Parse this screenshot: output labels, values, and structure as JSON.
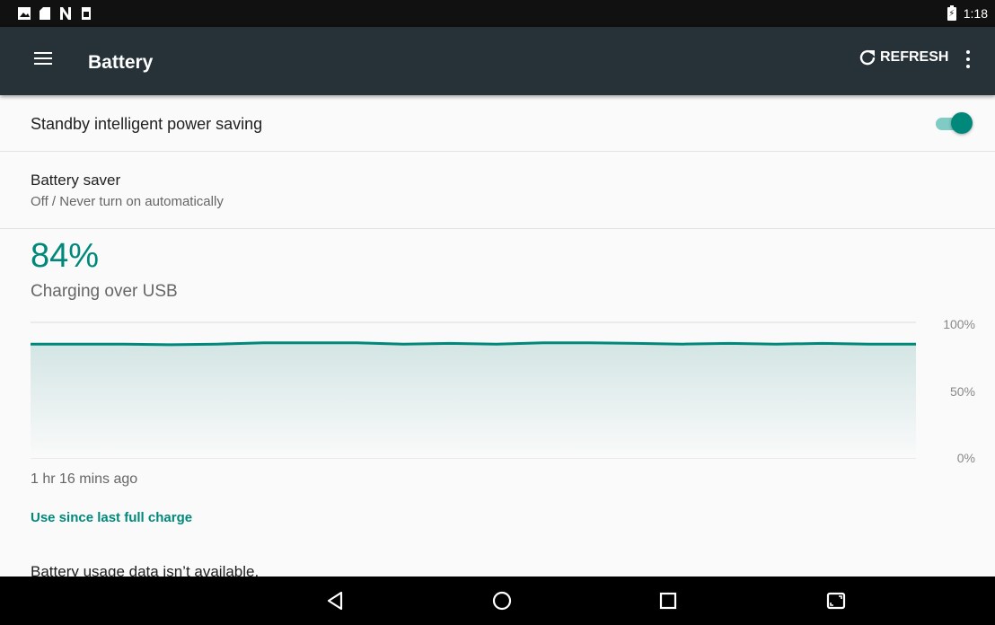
{
  "status_bar": {
    "time": "1:18",
    "icons": [
      "image-icon",
      "sd-card-icon",
      "n-icon",
      "storage-icon",
      "battery-charging-icon"
    ]
  },
  "app_bar": {
    "title": "Battery",
    "refresh_label": "REFRESH",
    "menu_icon": "menu-icon",
    "overflow_icon": "more-vert-icon"
  },
  "settings": {
    "standby_label": "Standby intelligent power saving",
    "standby_enabled": true,
    "saver_title": "Battery saver",
    "saver_summary": "Off / Never turn on automatically"
  },
  "battery": {
    "percent": "84%",
    "status": "Charging over USB",
    "time_ago": "1 hr 16 mins ago",
    "use_since_link": "Use since last full charge",
    "no_data_text": "Battery usage data isn’t available."
  },
  "chart_data": {
    "type": "area",
    "y_ticks": [
      "100%",
      "50%",
      "0%"
    ],
    "ylim": [
      0,
      100
    ],
    "grid": true,
    "x": [
      0,
      4,
      8,
      12,
      16,
      20,
      24,
      28,
      32,
      36,
      40,
      44,
      48,
      52,
      56,
      60,
      64,
      68,
      72,
      76
    ],
    "values": [
      84,
      84,
      84,
      83.5,
      84,
      85,
      85,
      85,
      84,
      84.5,
      84,
      85,
      85,
      84.5,
      84,
      84.5,
      84,
      84.5,
      84,
      84
    ],
    "xlabel": "",
    "ylabel": ""
  },
  "colors": {
    "accent": "#00897b",
    "app_bar": "#263238",
    "toggle_track": "#80cbc4"
  },
  "nav_bar": {
    "icons": [
      "back-icon",
      "home-icon",
      "recents-icon",
      "split-screen-icon"
    ]
  }
}
